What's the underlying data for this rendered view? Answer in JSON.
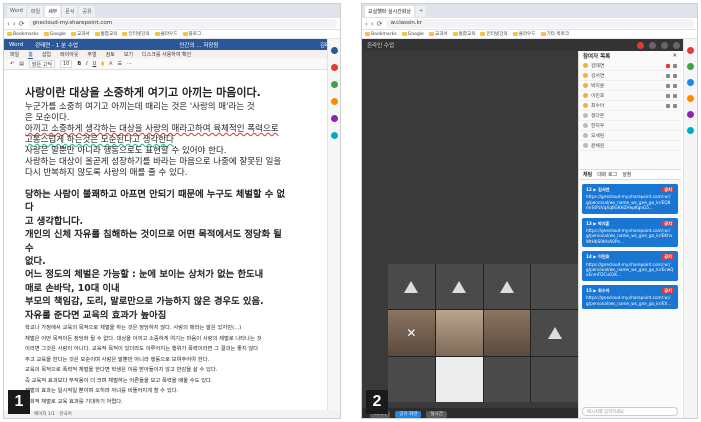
{
  "panel1": {
    "number": "1",
    "tabs": [
      "Word",
      "파일",
      "세부",
      "문서",
      "공유"
    ],
    "nav": {
      "back": "‹",
      "forward": "›",
      "reload": "⟳"
    },
    "url": "gnecloud-my.sharepoint.com",
    "bookmarks": [
      "Bookmarks",
      "Google",
      "교과서",
      "통합교육",
      "인터넷강의",
      "클라우드",
      "블로그",
      "기타 북마크"
    ],
    "word": {
      "app": "Word",
      "file": "강태연 - 1 분 수업",
      "title": "인간의 ... 저장됨",
      "user": "김태연",
      "ribbon_tabs": [
        "파일",
        "홈",
        "삽입",
        "레이아웃",
        "주얼",
        "검토",
        "보기",
        "디스크를 사용하여 확인",
        "열기",
        "검색"
      ],
      "ribbon_active": "홈",
      "font": "맑은 고딕",
      "size": "10"
    },
    "doc": {
      "heading": "사랑이란 대상을 소중하게 여기고 아끼는 마음이다.",
      "lines": [
        "누군가를 소중히 여기고 아끼는데 때리는 것은 '사랑의 매'라는 것",
        "은 모순이다.",
        "아끼고 소중하게 생각하는 대상을 사랑의 매라고하여 육체적인 폭력으로",
        "고통스럽게 하는것은 모순된다고 생각한다",
        "사랑은 말뿐만 아니라 행동으로도 표현할 수 있어야 한다.",
        "사랑하는 대상이 올곧게 성장하기를 바라는 마음으로 나중에 잘못된 일을",
        "다시 반복하지 않도록 사랑의 매를 줄 수 있다."
      ],
      "big": [
        "당하는 사람이 불쾌하고 아프면 안되기 때문에 누구도 체벌할 수 없다",
        "고 생각합니다.",
        "개인의 신체 자유를 침해하는 것이므로 어떤 목적에서도 정당화 될 수",
        "없다.",
        "어느 정도의 체벌은 가능할 : 눈에 보이는 상처가 없는 한도내",
        "매로 손바닥, 10대 이내",
        "부모의 책임감, 도리, 말로만으로 가능하지 않은 경우도 있음.",
        "자유를 준다면 교육의 효과가 높아짐"
      ],
      "small": [
        "학교나 가정에서 교육의 목적으로 체벌을 하는 것은 정당하지 않다. 사랑의 매라는 말은 있지만(...)",
        "체벌은 어떤 목적이든 정당화 될 수 없다. 대상을 아끼고 소중하게 여기는 마음이 사랑의 체벌로 나타나는 것",
        "이라면 그것은 사랑이 아니다. 교육적 목적이 있더라도 이루어지는 행위가 폭력이라면 그 결과는 좋지 않다",
        "주고 교육을 한다는 것은 모순이며 사랑은 말뿐만 아니라 행동으로 보여주어야 한다.",
        "교육의 목적으로 폭력적 체벌을 한다면 학생은 이를 받아들이지 않고 반감을 살 수 있다.",
        "즉 교육적 효과보다 부작용이 더 크며 체벌하는 어른들을 보고 폭력을 배울 수도 있다.",
        "체벌의 효과는 일시적일 뿐이며 오히려 자녀를 비뚤어지게 할 수 있다.",
        "일회적 체벌로 교육 효과를 기대하기 어렵다."
      ],
      "status": "페이지 1/1 · 한국어"
    }
  },
  "panel2": {
    "number": "2",
    "tabs": [
      "교실헬퍼 실시간화상",
      "+"
    ],
    "nav": {
      "back": "‹",
      "forward": "›",
      "reload": "⟳"
    },
    "url": "w.classin.kr",
    "bookmarks": [
      "Bookmarks",
      "Google",
      "교과서",
      "통합교육",
      "인터넷강의",
      "클라우드",
      "기타 북마크"
    ],
    "appbar_title": "온라인 수업",
    "participants_title": "참여자 목록",
    "participants": [
      "김태연",
      "김서연",
      "박지훈",
      "이민호",
      "최수아",
      "정다은",
      "한지우",
      "오세린",
      "윤채원"
    ],
    "chat_tabs": [
      "채팅",
      "대화 로그",
      "설정"
    ],
    "messages": [
      {
        "who": "12 ▶ 김서연",
        "tag": "공지",
        "text": "https://gnecloud-my.sharepoint.com/:w:/g/personal/ws_name_ws_gne_go_kr/EQ8mrStPzVqXq6GKHZHepKgnG5..."
      },
      {
        "who": "13 ▶ 박지훈",
        "tag": "공지",
        "text": "https://gnecloud-my.sharepoint.com/:w:/g/personal/ws_name_ws_gne_go_kr/EKhxWtHbS9tHrA0Pn..."
      },
      {
        "who": "14 ▶ 이민호",
        "tag": "공지",
        "text": "https://gnecloud-my.sharepoint.com/:w:/g/personal/ws_name_ws_gne_go_kr/EcwQxEnmFDCu01K..."
      },
      {
        "who": "15 ▶ 최수아",
        "tag": "공지",
        "text": "https://gnecloud-my.sharepoint.com/:w:/g/personal/ws_name_ws_gne_go_kr/EX..."
      }
    ],
    "chat_placeholder": "메시지를 입력하세요",
    "stage_buttons": [
      "나가기",
      "공유 화면",
      "실시간"
    ]
  },
  "colors": {
    "word_blue": "#2b579a",
    "accent_blue": "#1976d2",
    "record_red": "#e53935"
  }
}
